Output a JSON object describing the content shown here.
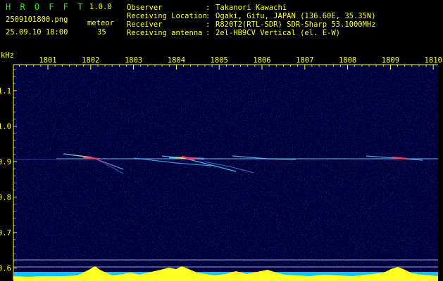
{
  "header": {
    "app_name": "H R O F F T",
    "version": "1.0.0",
    "filename": "2509101800.png",
    "datetime": "25.09.10 18:00",
    "meteor_label": "meteor",
    "meteor_count": "35"
  },
  "info": [
    {
      "key": "Observer",
      "sep": ":",
      "value": "Takanori Kawachi"
    },
    {
      "key": "Receiving Location",
      "sep": ":",
      "value": "Ogaki, Gifu, JAPAN (136.60E, 35.35N)"
    },
    {
      "key": "Receiver",
      "sep": ":",
      "value": "R820T2(RTL-SDR) SDR-Sharp 53.1000MHz"
    },
    {
      "key": "Receiving antenna",
      "sep": ":",
      "value": "2el-HB9CV Vertical (el. E-W)"
    }
  ],
  "axes": {
    "unit": "kHz",
    "time_ticks": [
      "1801",
      "1802",
      "1803",
      "1804",
      "1805",
      "1806",
      "1807",
      "1808",
      "1809",
      "1810"
    ],
    "freq_ticks": [
      "1.1",
      "1.0",
      "0.9",
      "0.8",
      "0.7",
      "0.6"
    ]
  },
  "colors": {
    "background": "#00003a",
    "header_green": "#22ee22",
    "label_yellow": "#ffff33",
    "carrier": "#6fc8ff",
    "meteor_hot": "#ff3366",
    "baseline": "#00c8ff"
  }
}
